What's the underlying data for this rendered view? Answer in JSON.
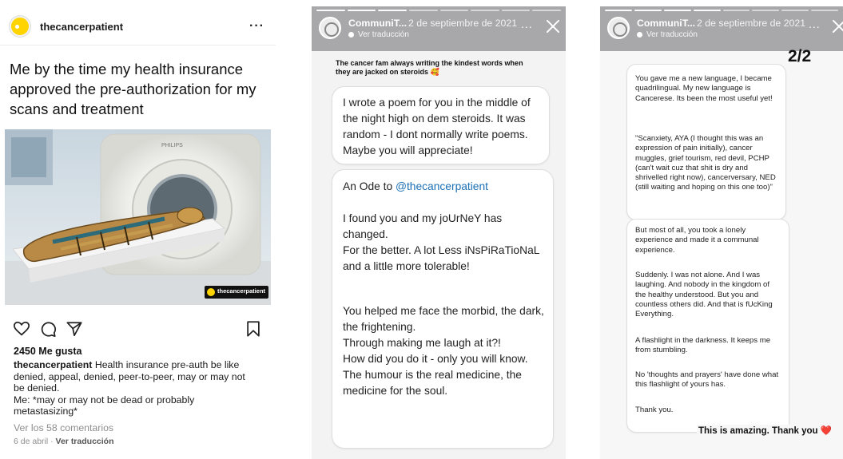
{
  "post": {
    "username": "thecancerpatient",
    "more": "···",
    "meme_text": "Me by the time my health insurance approved the pre-authorization for my scans and treatment",
    "image": {
      "scanner_brand": "PHILIPS",
      "watermark": "thecancerpatient"
    },
    "likes": "2450 Me gusta",
    "caption_user": "thecancerpatient",
    "caption_text": " Health insurance pre-auth be like denied, appeal, denied, peer-to-peer, may or may not be denied.",
    "caption_me": "Me: *may or may not be dead or probably metastasizing*",
    "view_comments": "Ver los 58 comentarios",
    "date": "6 de abril",
    "date_sep": " · ",
    "see_translation": "Ver traducción",
    "icons": [
      "heart-icon",
      "comment-icon",
      "share-icon",
      "bookmark-icon"
    ]
  },
  "story1": {
    "account": "CommuniT...",
    "date": "2 de septiembre de 2021",
    "translate": "Ver traducción",
    "more": "...",
    "headline": "The cancer fam always writing the kindest words when they are jacked on steroids 🥰",
    "bubble1": "I wrote a poem for you in the middle of the night high on dem steroids. It was random - I dont normally write poems. Maybe you will appreciate!",
    "ode_prefix": "An Ode to ",
    "ode_handle": "@thecancerpatient",
    "stanza1": "I found you and my joUrNeY has changed.\nFor the better. A lot Less iNsPiRaTioNaL and a little more tolerable!",
    "stanza2": "You helped me face the morbid, the dark, the frightening.\nThrough making me laugh at it?!\nHow did you do it - only you will know.\nThe humour is the real medicine, the medicine for the soul."
  },
  "story2": {
    "account": "CommuniT...",
    "date": "2 de septiembre de 2021",
    "translate": "Ver traducción",
    "more": "...",
    "pager": "2/2",
    "p1": "You gave me a new language, I became quadrilingual. My new language is Cancerese. Its been the most useful yet!",
    "p2": "\"Scanxiety, AYA (I thought this was an expression of pain initially), cancer muggles, grief tourism, red devil, PCHP (can't wait cuz that shit is dry and shrivelled right now), cancerversary, NED (still waiting and hoping on this one too)\"",
    "p3": "But most of all, you took a lonely experience and made it a communal experience.",
    "p4": "Suddenly. I was not alone. And I was laughing. And nobody in the kingdom of the healthy understood. But you and countless others did. And that is fUcKing Everything.",
    "p5": "A flashlight in the darkness. It keeps me from stumbling.",
    "p6": "No 'thoughts and prayers' have done what this flashlight of yours has.",
    "p7": "Thank you.",
    "reply": "This is amazing. Thank you ",
    "reply_heart": "❤️"
  },
  "colors": {
    "accent_yellow": "#ffd400",
    "link_blue": "#1a6fb5",
    "story_header_gray": "#a8a8aa",
    "heart_red": "#e0262d"
  }
}
